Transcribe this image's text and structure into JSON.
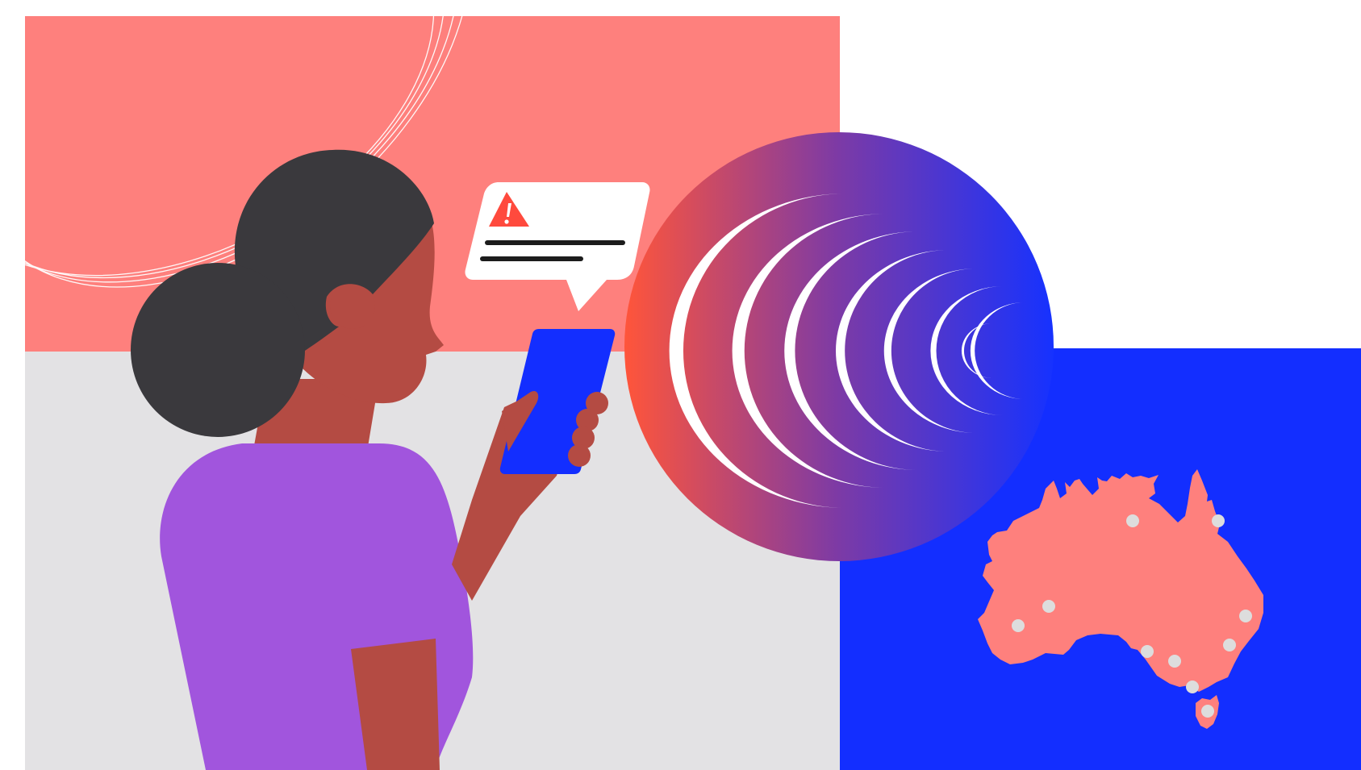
{
  "illustration": {
    "colors": {
      "background": "#ffffff",
      "salmon_panel": "#fe807d",
      "grey_panel": "#e3e2e4",
      "blue_panel": "#132eff",
      "hair": "#3a393d",
      "skin": "#b44b43",
      "shirt": "#a155dd",
      "phone": "#132eff",
      "bubble": "#ffffff",
      "bubble_lines": "#1c1c1c",
      "warning_triangle": "#ff4a3d",
      "warning_mark": "#ffffff",
      "gradient_start": "#ff553a",
      "gradient_mid": "#7c3aa6",
      "gradient_end": "#1632ff",
      "rings": "#ffffff",
      "map_fill": "#fe807d",
      "map_dots": "#dddddd"
    },
    "icons": {
      "notification": "warning-triangle-icon",
      "signal": "concentric-crescent-waves",
      "map": "australia-map"
    },
    "map_city_count": 10
  }
}
